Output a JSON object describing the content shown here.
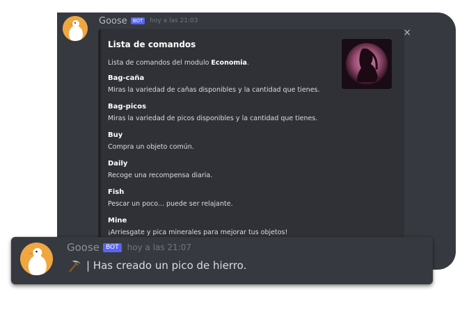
{
  "back_message": {
    "username": "Goose",
    "bot_badge": "BOT",
    "timestamp": "hoy a las 21:03",
    "close_icon": "×",
    "embed": {
      "title": "Lista de comandos",
      "description_prefix": "Lista de comandos del modulo ",
      "description_bold": "Economia",
      "description_suffix": ".",
      "fields": [
        {
          "name": "Bag-caña",
          "value": "Miras la variedad de cañas disponibles y la cantidad que tienes."
        },
        {
          "name": "Bag-picos",
          "value": "Miras la variedad de picos disponibles y la cantidad que tienes."
        },
        {
          "name": "Buy",
          "value": "Compra un objeto común."
        },
        {
          "name": "Daily",
          "value": "Recoge una recompensa diaria."
        },
        {
          "name": "Fish",
          "value": "Pescar un poco... puede ser relajante."
        },
        {
          "name": "Mine",
          "value": "¡Arriesgate y pica minerales para mejorar tus objetos!"
        }
      ]
    }
  },
  "front_message": {
    "username": "Goose",
    "bot_badge": "BOT",
    "timestamp": "hoy a las 21:07",
    "icon": "pickaxe-icon",
    "text": "| Has creado un pico de hierro."
  },
  "colors": {
    "card_bg": "#36393f",
    "embed_bg": "#2f3136",
    "bot_badge": "#5865f2",
    "avatar_bg": "#f0a641"
  }
}
